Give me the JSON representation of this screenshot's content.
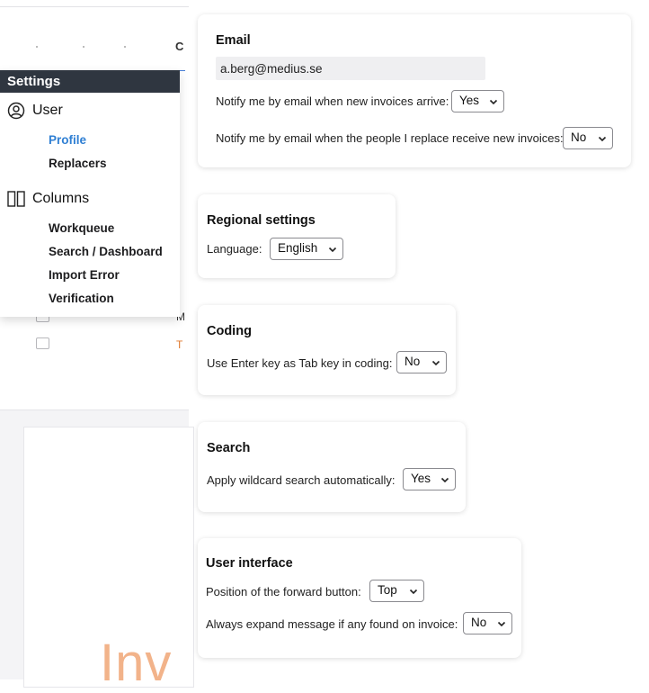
{
  "background": {
    "header_partial": "C",
    "row_mark_1": "M",
    "row_mark_2": "T",
    "doc_text": "Inv"
  },
  "menu": {
    "title": "Settings",
    "groups": [
      {
        "label": "User",
        "icon": "user-circle-icon",
        "items": [
          {
            "label": "Profile",
            "active": true
          },
          {
            "label": "Replacers",
            "active": false
          }
        ]
      },
      {
        "label": "Columns",
        "icon": "columns-icon",
        "items": [
          {
            "label": "Workqueue"
          },
          {
            "label": "Search / Dashboard"
          },
          {
            "label": "Import Error"
          },
          {
            "label": "Verification"
          }
        ]
      }
    ]
  },
  "email": {
    "title": "Email",
    "address": "a.berg@medius.se",
    "notify_new_label": "Notify me by email when new invoices arrive:",
    "notify_new_value": "Yes",
    "notify_replace_label": "Notify me by email when the people I replace receive new invoices:",
    "notify_replace_value": "No"
  },
  "regional": {
    "title": "Regional settings",
    "language_label": "Language:",
    "language_value": "English"
  },
  "coding": {
    "title": "Coding",
    "enter_tab_label": "Use Enter key as Tab key in coding:",
    "enter_tab_value": "No"
  },
  "search": {
    "title": "Search",
    "wildcard_label": "Apply wildcard search automatically:",
    "wildcard_value": "Yes"
  },
  "ui": {
    "title": "User interface",
    "forward_label": "Position of the forward button:",
    "forward_value": "Top",
    "expand_label": "Always expand message if any found on invoice:",
    "expand_value": "No"
  },
  "colors": {
    "menu_header_bg": "#2f3640",
    "active_link": "#2f7fd3"
  }
}
